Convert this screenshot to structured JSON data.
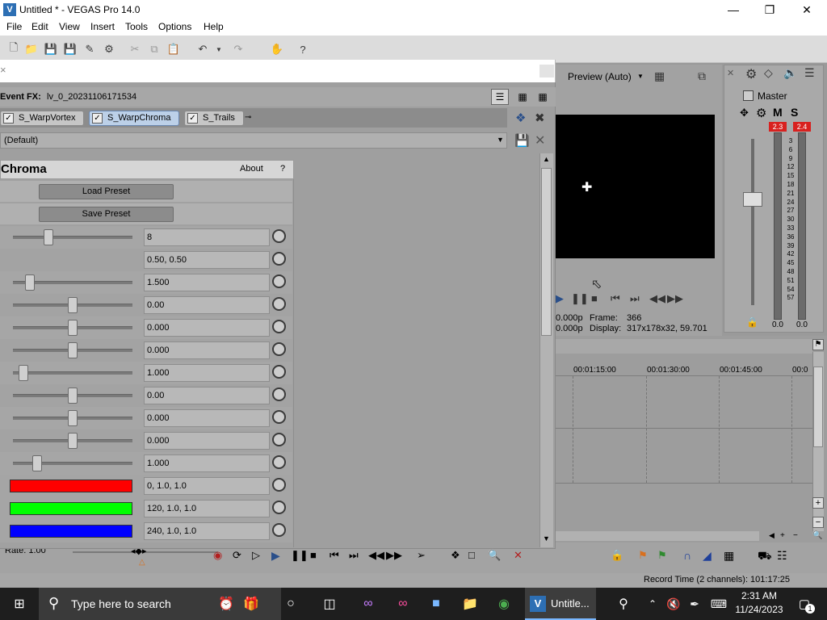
{
  "window": {
    "title": "Untitled * - VEGAS Pro 14.0",
    "app_icon": "vegas-logo-icon"
  },
  "menu": [
    "File",
    "Edit",
    "View",
    "Insert",
    "Tools",
    "Options",
    "Help"
  ],
  "fx_dialog": {
    "close_glyph": "×",
    "event_label": "Event FX:",
    "event_name": "lv_0_20231106171534",
    "chain": [
      "S_WarpVortex",
      "S_WarpChroma",
      "S_Trails"
    ],
    "preset": "(Default)",
    "plugin_title": "Chroma",
    "about": "About",
    "help": "?",
    "load_preset": "Load Preset",
    "save_preset": "Save Preset",
    "params": [
      {
        "value": "8",
        "slider": 0.3
      },
      {
        "value": "0.50, 0.50",
        "slider": null
      },
      {
        "value": "1.500",
        "slider": 0.14
      },
      {
        "value": "0.00",
        "slider": 0.5
      },
      {
        "value": "0.000",
        "slider": 0.5
      },
      {
        "value": "0.000",
        "slider": 0.5
      },
      {
        "value": "1.000",
        "slider": 0.09
      },
      {
        "value": "0.00",
        "slider": 0.5
      },
      {
        "value": "0.000",
        "slider": 0.5
      },
      {
        "value": "0.000",
        "slider": 0.5
      },
      {
        "value": "1.000",
        "slider": 0.2
      }
    ],
    "colors": [
      {
        "value": "0, 1.0, 1.0",
        "swatch": "#ff0000"
      },
      {
        "value": "120, 1.0, 1.0",
        "swatch": "#00ff00"
      },
      {
        "value": "240, 1.0, 1.0",
        "swatch": "#0000ff"
      }
    ]
  },
  "preview": {
    "quality": "Preview (Auto)",
    "frame_label": "Frame:",
    "frame_value": "366",
    "display_label": "Display:",
    "display_value": "317x178x32, 59.701",
    "res1": "0.000p",
    "res2": "0.000p"
  },
  "master": {
    "label": "Master",
    "m": "M",
    "s": "S",
    "peak_left": "2.3",
    "peak_right": "2.4",
    "scale": [
      "3",
      "6",
      "9",
      "12",
      "15",
      "18",
      "21",
      "24",
      "27",
      "30",
      "33",
      "36",
      "39",
      "42",
      "45",
      "48",
      "51",
      "54",
      "57"
    ],
    "bottom_left": "0.0",
    "bottom_right": "0.0"
  },
  "timeline": {
    "ruler": [
      "00:01:15:00",
      "00:01:30:00",
      "00:01:45:00",
      "00:0"
    ]
  },
  "transport": {
    "rate": "Rate: 1.00"
  },
  "status": {
    "record_time": "Record Time (2 channels): 101:17:25"
  },
  "taskbar": {
    "search_placeholder": "Type here to search",
    "active_app": "Untitle...",
    "time": "2:31 AM",
    "date": "11/24/2023",
    "notifications": "1"
  }
}
